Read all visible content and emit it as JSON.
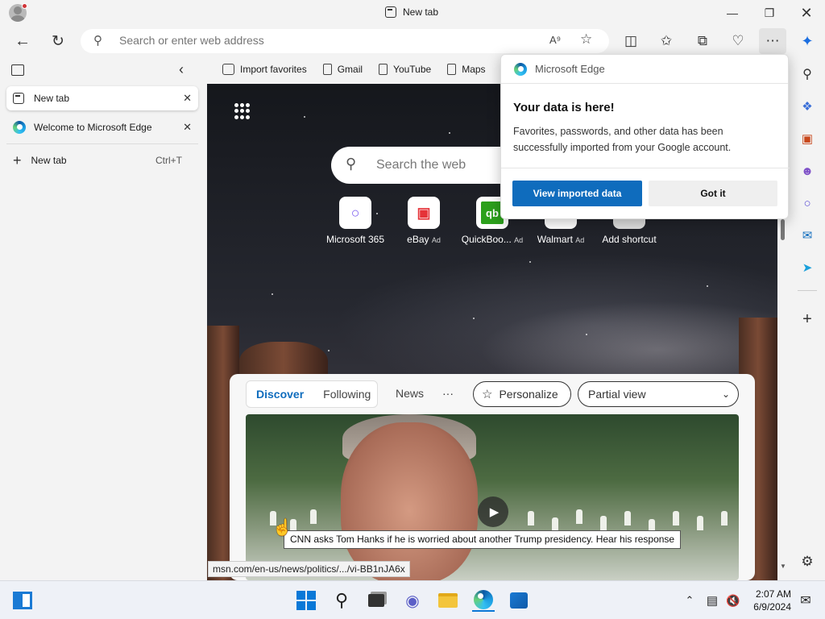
{
  "window": {
    "title": "New tab"
  },
  "toolbar": {
    "address_placeholder": "Search or enter web address"
  },
  "bookmarks": [
    {
      "label": "Import favorites"
    },
    {
      "label": "Gmail"
    },
    {
      "label": "YouTube"
    },
    {
      "label": "Maps"
    }
  ],
  "vertical_tabs": {
    "tabs": [
      {
        "label": "New tab",
        "active": true
      },
      {
        "label": "Welcome to Microsoft Edge",
        "active": false
      }
    ],
    "new_tab_label": "New tab",
    "new_tab_shortcut": "Ctrl+T"
  },
  "newtab": {
    "search_placeholder": "Search the web",
    "shortcuts": [
      {
        "label": "Microsoft 365",
        "ad": ""
      },
      {
        "label": "eBay",
        "ad": "Ad"
      },
      {
        "label": "QuickBoo...",
        "ad": "Ad"
      },
      {
        "label": "Walmart",
        "ad": "Ad"
      },
      {
        "label": "Add shortcut",
        "ad": ""
      }
    ],
    "feed_tabs": [
      "Discover",
      "Following",
      "News"
    ],
    "more": "···",
    "personalize": "Personalize",
    "view_select": "Partial view"
  },
  "tooltip": "CNN asks Tom Hanks if he is worried about another Trump presidency. Hear his response",
  "status_url": "msn.com/en-us/news/politics/.../vi-BB1nJA6x",
  "popup": {
    "brand": "Microsoft Edge",
    "title": "Your data is here!",
    "body": "Favorites, passwords, and other data has been successfully imported from your Google account.",
    "primary_button": "View imported data",
    "secondary_button": "Got it"
  },
  "clock": {
    "time": "2:07 AM",
    "date": "6/9/2024"
  },
  "colors": {
    "accent": "#0f6cbd",
    "taskbar": "#eef1f7",
    "chrome": "#f3f3f3"
  }
}
